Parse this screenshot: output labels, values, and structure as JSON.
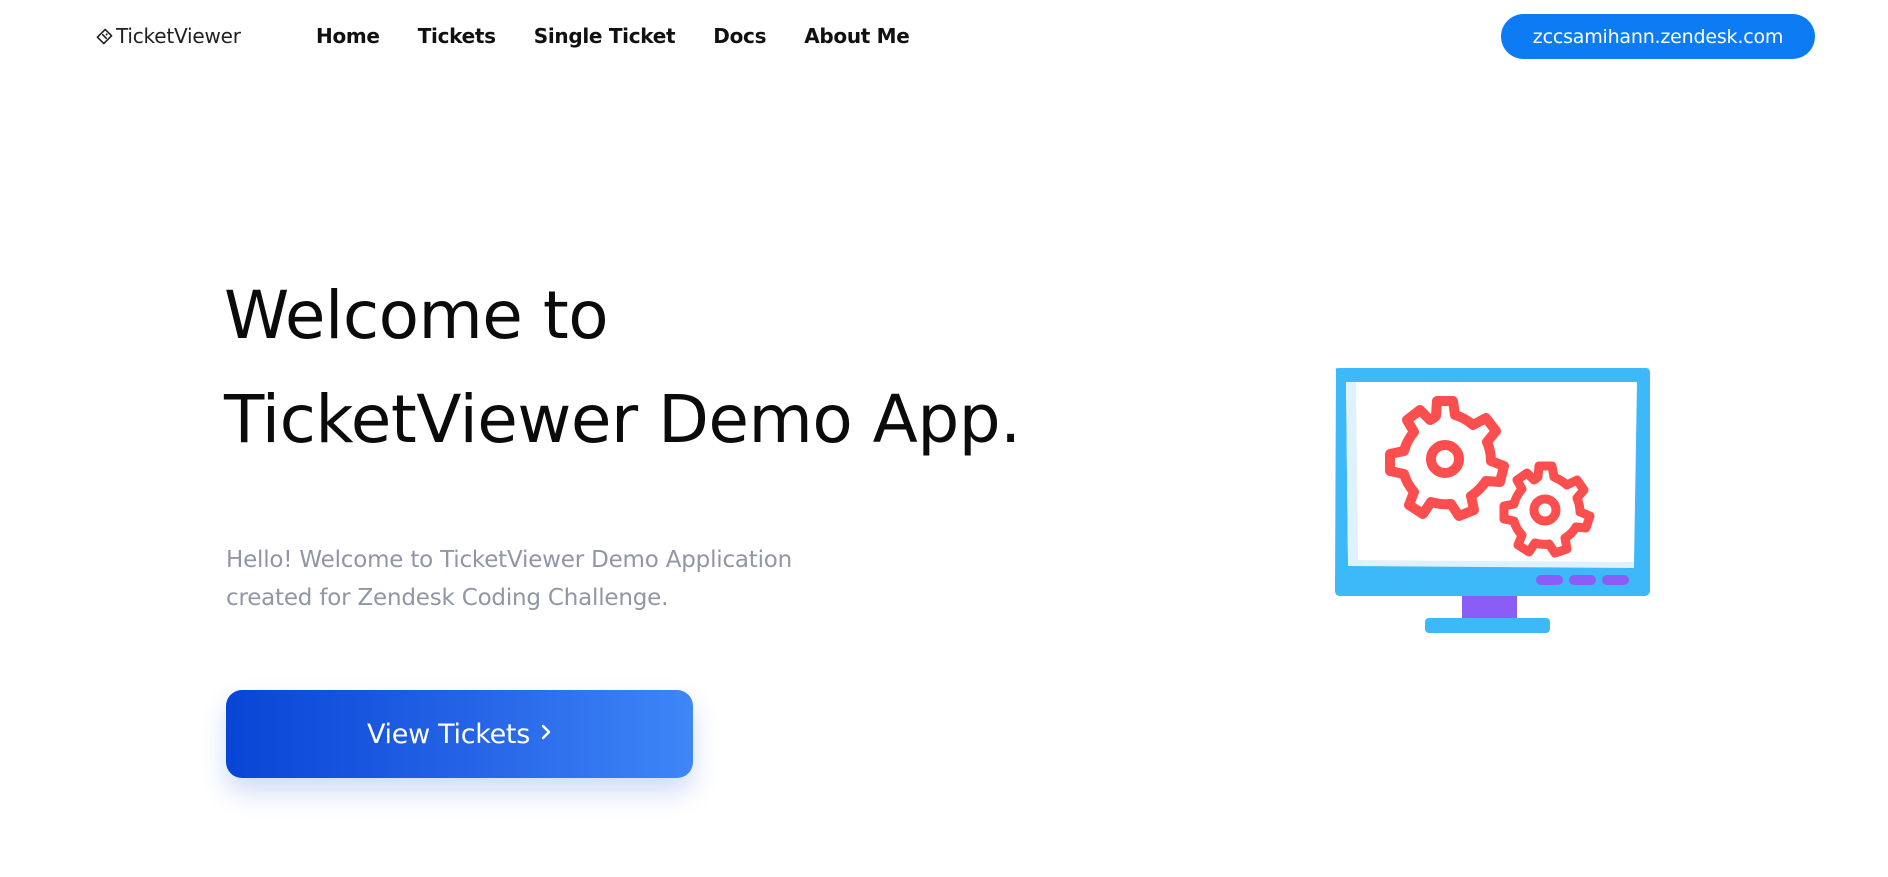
{
  "nav": {
    "brand": "TicketViewer",
    "links": [
      "Home",
      "Tickets",
      "Single Ticket",
      "Docs",
      "About Me"
    ],
    "domain_button": "zccsamihann.zendesk.com"
  },
  "hero": {
    "title_line1": "Welcome to",
    "title_line2": "TicketViewer Demo App.",
    "subtitle_line1": "Hello! Welcome to TicketViewer Demo Application",
    "subtitle_line2": "created for Zendesk Coding Challenge.",
    "cta_label": "View Tickets",
    "cta_icon": "chevron-right-icon"
  },
  "illustration": {
    "icon": "monitor-settings-icon",
    "colors": {
      "monitor": "#3db8f8",
      "screen": "#ffffff",
      "gears": "#fb4f4f",
      "accent": "#8b5cf6"
    }
  },
  "colors": {
    "primary": "#0d7cf4",
    "cta_gradient_start": "#0845d6",
    "cta_gradient_end": "#3f86f8",
    "subtitle_text": "#9196a5"
  }
}
